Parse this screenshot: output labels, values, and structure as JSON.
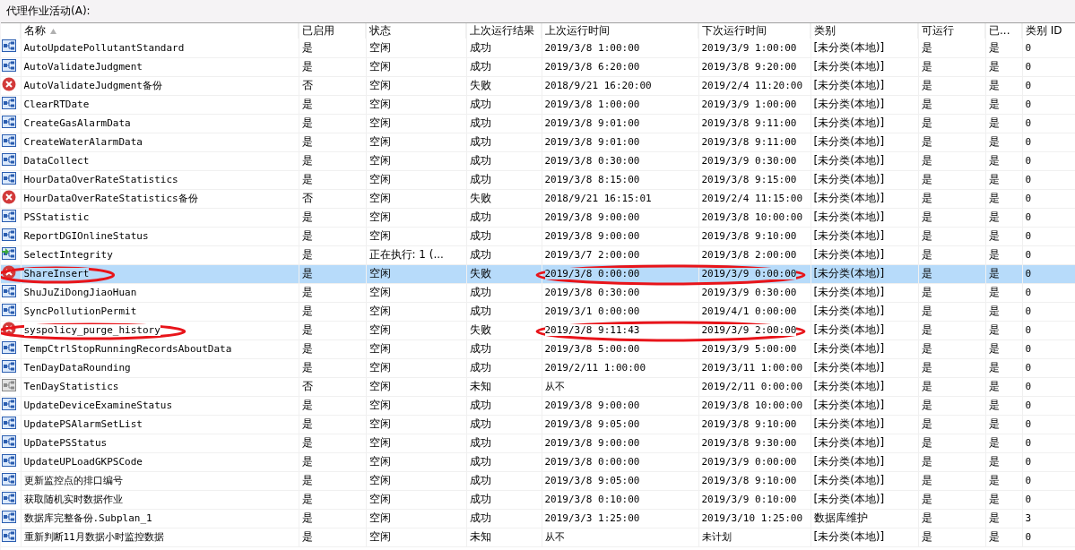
{
  "title": "代理作业活动(A):",
  "columns": [
    {
      "label": "名称",
      "sorted": true
    },
    {
      "label": "已启用",
      "sorted": false
    },
    {
      "label": "状态",
      "sorted": false
    },
    {
      "label": "上次运行结果",
      "sorted": false
    },
    {
      "label": "上次运行时间",
      "sorted": false
    },
    {
      "label": "下次运行时间",
      "sorted": false
    },
    {
      "label": "类别",
      "sorted": false
    },
    {
      "label": "可运行",
      "sorted": false
    },
    {
      "label": "已...",
      "sorted": false
    },
    {
      "label": "类别 ID",
      "sorted": false
    }
  ],
  "rows": [
    {
      "kind": "job",
      "selected": false,
      "circled_name": false,
      "circled_times": false,
      "cells": [
        "AutoUpdatePollutantStandard",
        "是",
        "空闲",
        "成功",
        "2019/3/8 1:00:00",
        "2019/3/9 1:00:00",
        "[未分类(本地)]",
        "是",
        "是",
        "0"
      ]
    },
    {
      "kind": "job",
      "selected": false,
      "circled_name": false,
      "circled_times": false,
      "cells": [
        "AutoValidateJudgment",
        "是",
        "空闲",
        "成功",
        "2019/3/8 6:20:00",
        "2019/3/8 9:20:00",
        "[未分类(本地)]",
        "是",
        "是",
        "0"
      ]
    },
    {
      "kind": "failed",
      "selected": false,
      "circled_name": false,
      "circled_times": false,
      "cells": [
        "AutoValidateJudgment备份",
        "否",
        "空闲",
        "失败",
        "2018/9/21 16:20:00",
        "2019/2/4 11:20:00",
        "[未分类(本地)]",
        "是",
        "是",
        "0"
      ]
    },
    {
      "kind": "job",
      "selected": false,
      "circled_name": false,
      "circled_times": false,
      "cells": [
        "ClearRTDate",
        "是",
        "空闲",
        "成功",
        "2019/3/8 1:00:00",
        "2019/3/9 1:00:00",
        "[未分类(本地)]",
        "是",
        "是",
        "0"
      ]
    },
    {
      "kind": "job",
      "selected": false,
      "circled_name": false,
      "circled_times": false,
      "cells": [
        "CreateGasAlarmData",
        "是",
        "空闲",
        "成功",
        "2019/3/8 9:01:00",
        "2019/3/8 9:11:00",
        "[未分类(本地)]",
        "是",
        "是",
        "0"
      ]
    },
    {
      "kind": "job",
      "selected": false,
      "circled_name": false,
      "circled_times": false,
      "cells": [
        "CreateWaterAlarmData",
        "是",
        "空闲",
        "成功",
        "2019/3/8 9:01:00",
        "2019/3/8 9:11:00",
        "[未分类(本地)]",
        "是",
        "是",
        "0"
      ]
    },
    {
      "kind": "job",
      "selected": false,
      "circled_name": false,
      "circled_times": false,
      "cells": [
        "DataCollect",
        "是",
        "空闲",
        "成功",
        "2019/3/8 0:30:00",
        "2019/3/9 0:30:00",
        "[未分类(本地)]",
        "是",
        "是",
        "0"
      ]
    },
    {
      "kind": "job",
      "selected": false,
      "circled_name": false,
      "circled_times": false,
      "cells": [
        "HourDataOverRateStatistics",
        "是",
        "空闲",
        "成功",
        "2019/3/8 8:15:00",
        "2019/3/8 9:15:00",
        "[未分类(本地)]",
        "是",
        "是",
        "0"
      ]
    },
    {
      "kind": "failed",
      "selected": false,
      "circled_name": false,
      "circled_times": false,
      "cells": [
        "HourDataOverRateStatistics备份",
        "否",
        "空闲",
        "失败",
        "2018/9/21 16:15:01",
        "2019/2/4 11:15:00",
        "[未分类(本地)]",
        "是",
        "是",
        "0"
      ]
    },
    {
      "kind": "job",
      "selected": false,
      "circled_name": false,
      "circled_times": false,
      "cells": [
        "PSStatistic",
        "是",
        "空闲",
        "成功",
        "2019/3/8 9:00:00",
        "2019/3/8 10:00:00",
        "[未分类(本地)]",
        "是",
        "是",
        "0"
      ]
    },
    {
      "kind": "job",
      "selected": false,
      "circled_name": false,
      "circled_times": false,
      "cells": [
        "ReportDGIOnlineStatus",
        "是",
        "空闲",
        "成功",
        "2019/3/8 9:00:00",
        "2019/3/8 9:10:00",
        "[未分类(本地)]",
        "是",
        "是",
        "0"
      ]
    },
    {
      "kind": "running",
      "selected": false,
      "circled_name": false,
      "circled_times": false,
      "cells": [
        "SelectIntegrity",
        "是",
        "正在执行: 1 (...",
        "成功",
        "2019/3/7 2:00:00",
        "2019/3/8 2:00:00",
        "[未分类(本地)]",
        "是",
        "是",
        "0"
      ]
    },
    {
      "kind": "failed",
      "selected": true,
      "circled_name": true,
      "circled_times": true,
      "cells": [
        "ShareInsert",
        "是",
        "空闲",
        "失败",
        "2019/3/8 0:00:00",
        "2019/3/9 0:00:00",
        "[未分类(本地)]",
        "是",
        "是",
        "0"
      ]
    },
    {
      "kind": "job",
      "selected": false,
      "circled_name": false,
      "circled_times": false,
      "cells": [
        "ShuJuZiDongJiaoHuan",
        "是",
        "空闲",
        "成功",
        "2019/3/8 0:30:00",
        "2019/3/9 0:30:00",
        "[未分类(本地)]",
        "是",
        "是",
        "0"
      ]
    },
    {
      "kind": "job",
      "selected": false,
      "circled_name": false,
      "circled_times": false,
      "cells": [
        "SyncPollutionPermit",
        "是",
        "空闲",
        "成功",
        "2019/3/1 0:00:00",
        "2019/4/1 0:00:00",
        "[未分类(本地)]",
        "是",
        "是",
        "0"
      ]
    },
    {
      "kind": "failed",
      "selected": false,
      "circled_name": true,
      "circled_times": true,
      "cells": [
        "syspolicy_purge_history",
        "是",
        "空闲",
        "失败",
        "2019/3/8 9:11:43",
        "2019/3/9 2:00:00",
        "[未分类(本地)]",
        "是",
        "是",
        "0"
      ]
    },
    {
      "kind": "job",
      "selected": false,
      "circled_name": false,
      "circled_times": false,
      "cells": [
        "TempCtrlStopRunningRecordsAboutData",
        "是",
        "空闲",
        "成功",
        "2019/3/8 5:00:00",
        "2019/3/9 5:00:00",
        "[未分类(本地)]",
        "是",
        "是",
        "0"
      ]
    },
    {
      "kind": "job",
      "selected": false,
      "circled_name": false,
      "circled_times": false,
      "cells": [
        "TenDayDataRounding",
        "是",
        "空闲",
        "成功",
        "2019/2/11 1:00:00",
        "2019/3/11 1:00:00",
        "[未分类(本地)]",
        "是",
        "是",
        "0"
      ]
    },
    {
      "kind": "disabled",
      "selected": false,
      "circled_name": false,
      "circled_times": false,
      "cells": [
        "TenDayStatistics",
        "否",
        "空闲",
        "未知",
        "从不",
        "2019/2/11 0:00:00",
        "[未分类(本地)]",
        "是",
        "是",
        "0"
      ]
    },
    {
      "kind": "job",
      "selected": false,
      "circled_name": false,
      "circled_times": false,
      "cells": [
        "UpdateDeviceExamineStatus",
        "是",
        "空闲",
        "成功",
        "2019/3/8 9:00:00",
        "2019/3/8 10:00:00",
        "[未分类(本地)]",
        "是",
        "是",
        "0"
      ]
    },
    {
      "kind": "job",
      "selected": false,
      "circled_name": false,
      "circled_times": false,
      "cells": [
        "UpdatePSAlarmSetList",
        "是",
        "空闲",
        "成功",
        "2019/3/8 9:05:00",
        "2019/3/8 9:10:00",
        "[未分类(本地)]",
        "是",
        "是",
        "0"
      ]
    },
    {
      "kind": "job",
      "selected": false,
      "circled_name": false,
      "circled_times": false,
      "cells": [
        "UpDatePSStatus",
        "是",
        "空闲",
        "成功",
        "2019/3/8 9:00:00",
        "2019/3/8 9:30:00",
        "[未分类(本地)]",
        "是",
        "是",
        "0"
      ]
    },
    {
      "kind": "job",
      "selected": false,
      "circled_name": false,
      "circled_times": false,
      "cells": [
        "UpdateUPLoadGKPSCode",
        "是",
        "空闲",
        "成功",
        "2019/3/8 0:00:00",
        "2019/3/9 0:00:00",
        "[未分类(本地)]",
        "是",
        "是",
        "0"
      ]
    },
    {
      "kind": "job",
      "selected": false,
      "circled_name": false,
      "circled_times": false,
      "cells": [
        "更新监控点的排口编号",
        "是",
        "空闲",
        "成功",
        "2019/3/8 9:05:00",
        "2019/3/8 9:10:00",
        "[未分类(本地)]",
        "是",
        "是",
        "0"
      ]
    },
    {
      "kind": "job",
      "selected": false,
      "circled_name": false,
      "circled_times": false,
      "cells": [
        "获取随机实时数据作业",
        "是",
        "空闲",
        "成功",
        "2019/3/8 0:10:00",
        "2019/3/9 0:10:00",
        "[未分类(本地)]",
        "是",
        "是",
        "0"
      ]
    },
    {
      "kind": "job",
      "selected": false,
      "circled_name": false,
      "circled_times": false,
      "cells": [
        "数据库完整备份.Subplan_1",
        "是",
        "空闲",
        "成功",
        "2019/3/3 1:25:00",
        "2019/3/10 1:25:00",
        "数据库维护",
        "是",
        "是",
        "3"
      ]
    },
    {
      "kind": "job",
      "selected": false,
      "circled_name": false,
      "circled_times": false,
      "cells": [
        "重新判断11月数据小时监控数据",
        "是",
        "空闲",
        "未知",
        "从不",
        "未计划",
        "[未分类(本地)]",
        "是",
        "是",
        "0"
      ]
    }
  ]
}
